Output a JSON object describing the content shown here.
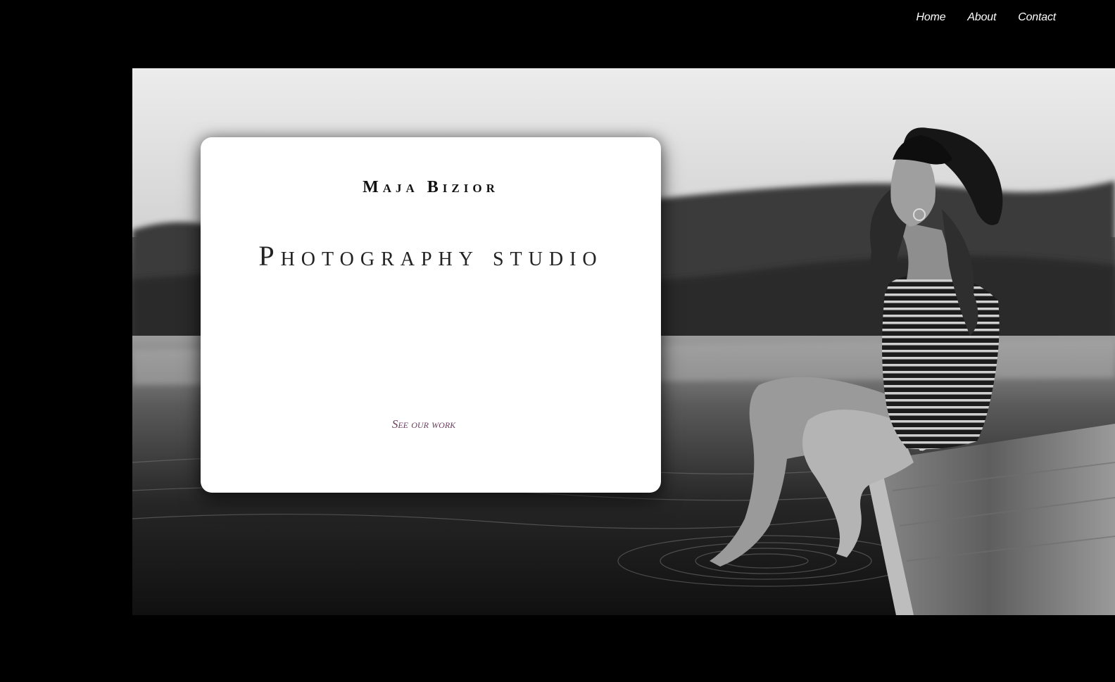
{
  "nav": {
    "items": [
      {
        "label": "Home"
      },
      {
        "label": "About"
      },
      {
        "label": "Contact"
      }
    ]
  },
  "hero": {
    "name": "Maja Bizior",
    "title": "Photography studio",
    "cta": "See our work"
  },
  "colors": {
    "background": "#000000",
    "card": "#ffffff",
    "cta": "#6b3d5e",
    "nav_text": "#ffffff"
  }
}
